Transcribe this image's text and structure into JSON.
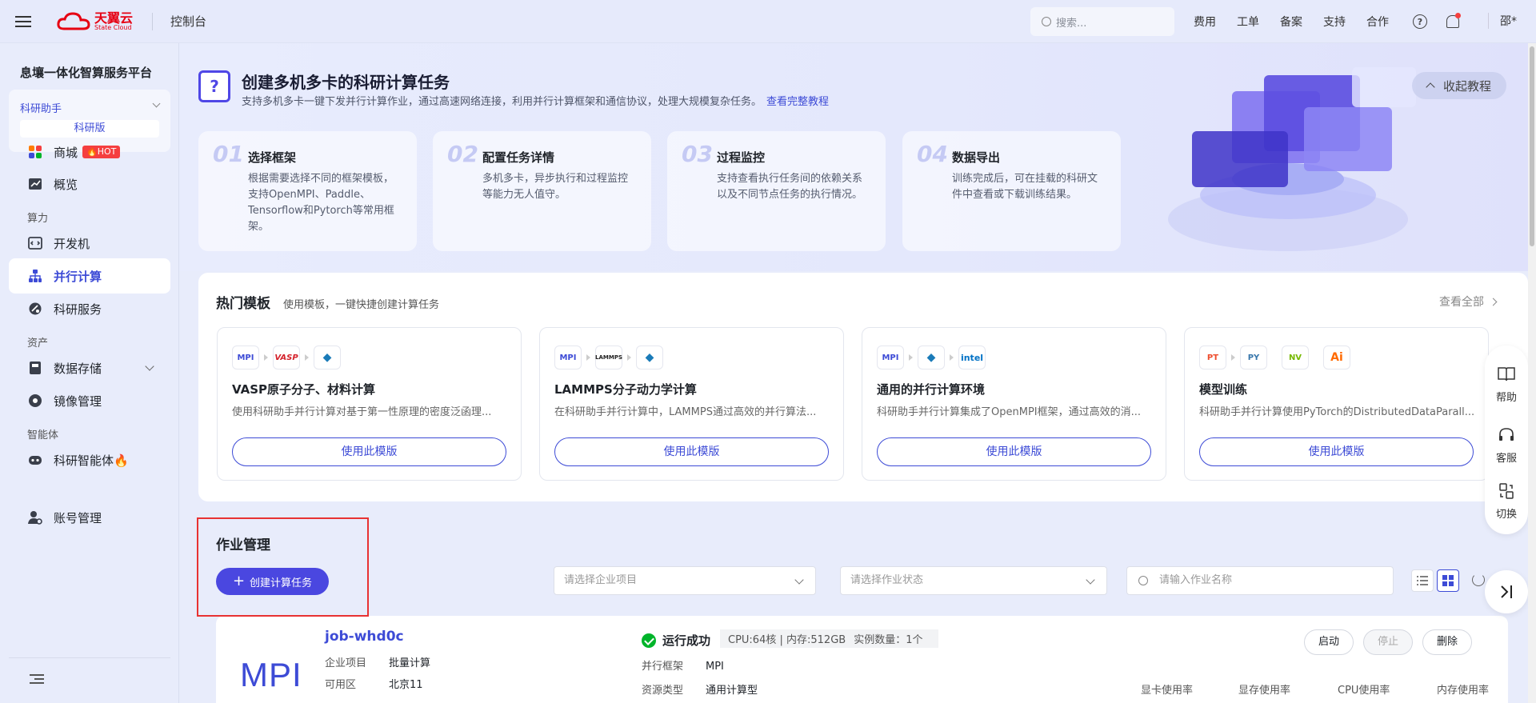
{
  "topbar": {
    "logo_cn": "天翼云",
    "logo_en": "State Cloud",
    "console": "控制台",
    "search_placeholder": "搜索...",
    "nav": [
      "费用",
      "工单",
      "备案",
      "支持",
      "合作"
    ],
    "help_glyph": "?",
    "user": "邵*"
  },
  "sidebar": {
    "platform": "息壤一体化智算服务平台",
    "assistant": "科研助手",
    "edition": "科研版",
    "items": [
      {
        "label": "商城",
        "badge": "HOT"
      },
      {
        "label": "概览"
      },
      {
        "section": "算力"
      },
      {
        "label": "开发机"
      },
      {
        "label": "并行计算"
      },
      {
        "label": "科研服务"
      },
      {
        "section": "资产"
      },
      {
        "label": "数据存储"
      },
      {
        "label": "镜像管理"
      },
      {
        "section": "智能体"
      },
      {
        "label": "科研智能体🔥"
      },
      {
        "label": "账号管理"
      }
    ]
  },
  "hero": {
    "icon": "?",
    "title": "创建多机多卡的科研计算任务",
    "subtitle": "支持多机多卡一键下发并行计算作业，通过高速网络连接，利用并行计算框架和通信协议，处理大规模复杂任务。",
    "link": "查看完整教程",
    "collapse": "收起教程",
    "steps": [
      {
        "num": "01",
        "title": "选择框架",
        "desc": "根据需要选择不同的框架模板，支持OpenMPI、Paddle、Tensorflow和Pytorch等常用框架。"
      },
      {
        "num": "02",
        "title": "配置任务详情",
        "desc": "多机多卡，异步执行和过程监控等能力无人值守。"
      },
      {
        "num": "03",
        "title": "过程监控",
        "desc": "支持查看执行任务间的依赖关系以及不同节点任务的执行情况。"
      },
      {
        "num": "04",
        "title": "数据导出",
        "desc": "训练完成后，可在挂载的科研文件中查看或下载训练结果。"
      }
    ]
  },
  "templates": {
    "title": "热门模板",
    "subtitle": "使用模板，一键快捷创建计算任务",
    "view_all": "查看全部",
    "cards": [
      {
        "icons": [
          "MPI",
          "VASP",
          "◆"
        ],
        "name": "VASP原子分子、材料计算",
        "desc": "使用科研助手并行计算对基于第一性原理的密度泛函理...",
        "button": "使用此模版"
      },
      {
        "icons": [
          "MPI",
          "LAMMPS",
          "◆"
        ],
        "name": "LAMMPS分子动力学计算",
        "desc": "在科研助手并行计算中，LAMMPS通过高效的并行算法...",
        "button": "使用此模版"
      },
      {
        "icons": [
          "MPI",
          "◆",
          "intel"
        ],
        "name": "通用的并行计算环境",
        "desc": "科研助手并行计算集成了OpenMPI框架，通过高效的消...",
        "button": "使用此模版"
      },
      {
        "icons": [
          "PT",
          "PY",
          "NV",
          "Ai"
        ],
        "name": "模型训练",
        "desc": "科研助手并行计算使用PyTorch的DistributedDataParall...",
        "button": "使用此模版"
      }
    ]
  },
  "jobs": {
    "title": "作业管理",
    "create": "创建计算任务",
    "project_placeholder": "请选择企业项目",
    "status_placeholder": "请选择作业状态",
    "name_placeholder": "请输入作业名称",
    "job": {
      "logo": "MPI",
      "name": "job-whd0c",
      "project_label": "企业项目",
      "project": "批量计算",
      "zone_label": "可用区",
      "zone": "北京11",
      "status": "运行成功",
      "cpu": "CPU:64核 | 内存:512GB",
      "instances": "实例数量：1个",
      "framework_label": "并行框架",
      "framework": "MPI",
      "restype_label": "资源类型",
      "restype": "通用计算型",
      "buttons": [
        "启动",
        "停止",
        "删除"
      ],
      "usage": [
        "显卡使用率",
        "显存使用率",
        "CPU使用率",
        "内存使用率"
      ]
    }
  },
  "float_tools": [
    "帮助",
    "客服",
    "切换"
  ],
  "colors": {
    "primary": "#3d4bd6",
    "create_btn": "#4a47e0",
    "success": "#00b42a",
    "hot": "#f53f3f",
    "highlight": "#e83232"
  }
}
